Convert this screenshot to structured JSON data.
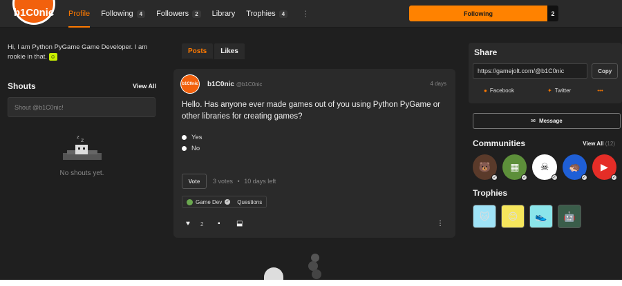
{
  "logo": {
    "text": "b1C0nic"
  },
  "nav": {
    "items": [
      {
        "label": "Profile",
        "count": ""
      },
      {
        "label": "Following",
        "count": "4"
      },
      {
        "label": "Followers",
        "count": "2"
      },
      {
        "label": "Library",
        "count": ""
      },
      {
        "label": "Trophies",
        "count": "4"
      }
    ],
    "more": "⋮"
  },
  "follow": {
    "label": "Following",
    "count": "2"
  },
  "bio": {
    "text": "Hi, I am Python PyGame Game Developer. I am rookie in that."
  },
  "shouts": {
    "title": "Shouts",
    "view_all": "View All",
    "placeholder": "Shout @b1C0nic!",
    "empty": "No shouts yet."
  },
  "tabs": [
    "Posts",
    "Likes"
  ],
  "post": {
    "avatar_text": "b1C0nic",
    "author": "b1C0nic",
    "handle": "@b1C0nic",
    "time": "4 days",
    "text": "Hello. Has anyone ever made games out of you using Python PyGame or other libraries for creating games?",
    "options": [
      "Yes",
      "No"
    ],
    "vote_label": "Vote",
    "votes": "3 votes",
    "separator": "•",
    "time_left": "10 days left",
    "tag_main": "Game Dev",
    "tag_sub": "Questions",
    "likes": "2"
  },
  "share": {
    "title": "Share",
    "url": "https://gamejolt.com/@b1C0nic",
    "copy": "Copy",
    "facebook": "Facebook",
    "twitter": "Twitter",
    "more": "•••"
  },
  "message": {
    "label": "Message"
  },
  "communities": {
    "title": "Communities",
    "view_all": "View All",
    "count": "(12)",
    "items": [
      {
        "name": "fnaf-community",
        "color": "#5a3a2a",
        "glyph": "🐻"
      },
      {
        "name": "minecraft-community",
        "color": "#5d8f3a",
        "glyph": "▦"
      },
      {
        "name": "undertale-community",
        "color": "#ffffff",
        "glyph": "☠"
      },
      {
        "name": "sonic-community",
        "color": "#1f5fd6",
        "glyph": "🦔"
      },
      {
        "name": "youtube-community",
        "color": "#e52d27",
        "glyph": "▶"
      }
    ]
  },
  "trophies": {
    "title": "Trophies",
    "items": [
      {
        "name": "trophy-1",
        "color": "#9fe3f7",
        "glyph": "🐱"
      },
      {
        "name": "trophy-2",
        "color": "#f6e65c",
        "glyph": "😊"
      },
      {
        "name": "trophy-3",
        "color": "#8be5ea",
        "glyph": "👟"
      },
      {
        "name": "trophy-4",
        "color": "#3a5d4a",
        "glyph": "🤖"
      }
    ]
  },
  "colors": {
    "accent": "#ff7a00",
    "follow_bg": "#ff8200",
    "bg": "#1f1f1f",
    "panel": "#2a2a2a"
  }
}
